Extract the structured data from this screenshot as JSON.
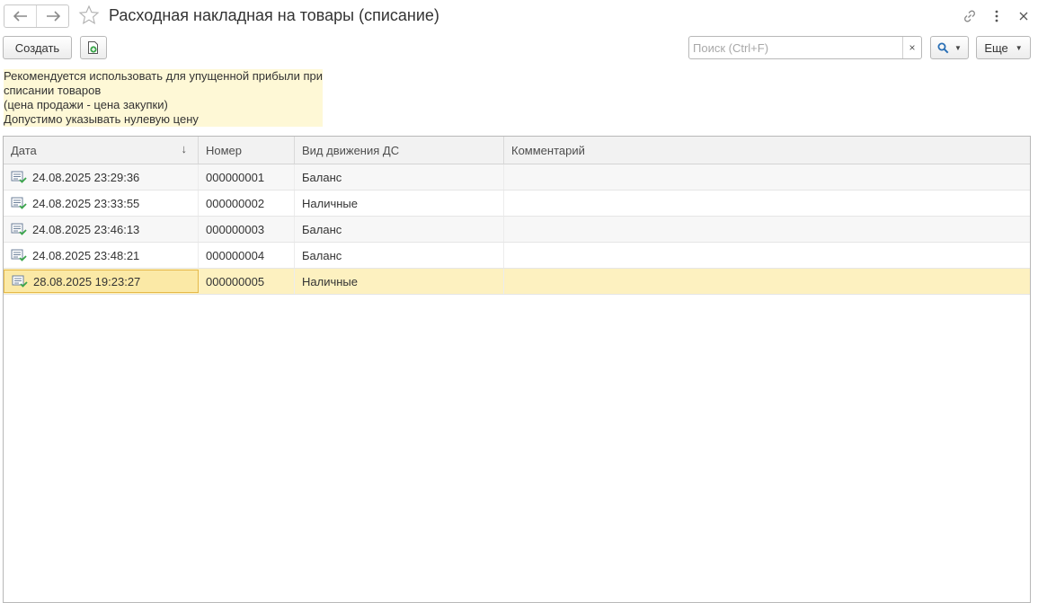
{
  "window": {
    "title": "Расходная накладная на товары (списание)",
    "icons": [
      "back-arrow-icon",
      "forward-arrow-icon",
      "star-icon",
      "link-icon",
      "more-vertical-icon",
      "close-icon"
    ]
  },
  "toolbar": {
    "create_label": "Создать",
    "search_placeholder": "Поиск (Ctrl+F)",
    "search_clear": "×",
    "more_label": "Еще"
  },
  "note": {
    "lines": [
      "Рекомендуется использовать для упущенной прибыли при",
      "списании товаров",
      "(цена продажи - цена закупки)",
      "Допустимо указывать нулевую цену"
    ],
    "background": "#fef8d6"
  },
  "table": {
    "columns": [
      "Дата",
      "Номер",
      "Вид движения ДС",
      "Комментарий"
    ],
    "sort_indicator": "↓",
    "rows": [
      {
        "date": "24.08.2025 23:29:36",
        "number": "000000001",
        "kind": "Баланс",
        "comment": ""
      },
      {
        "date": "24.08.2025 23:33:55",
        "number": "000000002",
        "kind": "Наличные",
        "comment": ""
      },
      {
        "date": "24.08.2025 23:46:13",
        "number": "000000003",
        "kind": "Баланс",
        "comment": ""
      },
      {
        "date": "24.08.2025 23:48:21",
        "number": "000000004",
        "kind": "Баланс",
        "comment": ""
      },
      {
        "date": "28.08.2025 19:23:27",
        "number": "000000005",
        "kind": "Наличные",
        "comment": ""
      }
    ],
    "selected_row": 4,
    "selected_color": "#fdf1c0"
  }
}
